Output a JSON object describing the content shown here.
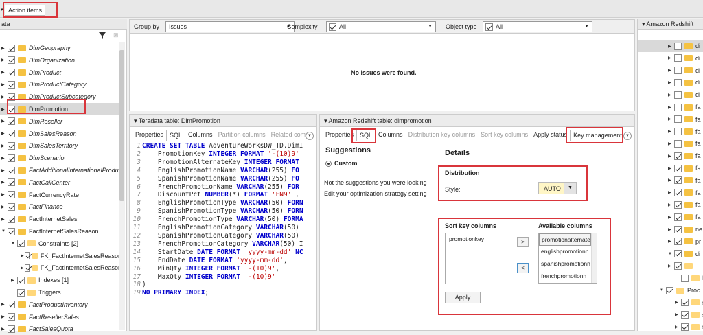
{
  "top_tab": "Action items",
  "left": {
    "header": "ata",
    "items": [
      {
        "t": "DimGeography",
        "lvl": 0,
        "c": true,
        "i": true
      },
      {
        "t": "DimOrganization",
        "lvl": 0,
        "c": true,
        "i": true
      },
      {
        "t": "DimProduct",
        "lvl": 0,
        "c": true,
        "i": true
      },
      {
        "t": "DimProductCategory",
        "lvl": 0,
        "c": true,
        "i": true
      },
      {
        "t": "DimProductSubcategory",
        "lvl": 0,
        "c": true,
        "i": true
      },
      {
        "t": "DimPromotion",
        "lvl": 0,
        "c": true,
        "i": false,
        "sel": true
      },
      {
        "t": "DimReseller",
        "lvl": 0,
        "c": true,
        "i": true
      },
      {
        "t": "DimSalesReason",
        "lvl": 0,
        "c": true,
        "i": true
      },
      {
        "t": "DimSalesTerritory",
        "lvl": 0,
        "c": true,
        "i": true
      },
      {
        "t": "DimScenario",
        "lvl": 0,
        "c": true,
        "i": true
      },
      {
        "t": "FactAdditionalInternationalProdu",
        "lvl": 0,
        "c": true,
        "i": true
      },
      {
        "t": "FactCallCenter",
        "lvl": 0,
        "c": true,
        "i": true
      },
      {
        "t": "FactCurrencyRate",
        "lvl": 0,
        "c": true,
        "i": false
      },
      {
        "t": "FactFinance",
        "lvl": 0,
        "c": true,
        "i": true
      },
      {
        "t": "FactInternetSales",
        "lvl": 0,
        "c": true,
        "i": false
      },
      {
        "t": "FactInternetSalesReason",
        "lvl": 0,
        "c": true,
        "i": false,
        "open": true
      },
      {
        "t": "Constraints [2]",
        "lvl": 1,
        "c": true,
        "i": false,
        "open": true,
        "folder": true
      },
      {
        "t": "FK_FactInternetSalesReason",
        "lvl": 2,
        "c": true,
        "i": false,
        "folder": true
      },
      {
        "t": "FK_FactInternetSalesReason",
        "lvl": 2,
        "c": true,
        "i": false,
        "folder": true
      },
      {
        "t": "Indexes [1]",
        "lvl": 1,
        "c": true,
        "i": false,
        "folder": true
      },
      {
        "t": "Triggers",
        "lvl": 1,
        "c": true,
        "i": false,
        "folder": true,
        "noarrow": true
      },
      {
        "t": "FactProductInventory",
        "lvl": 0,
        "c": true,
        "i": true
      },
      {
        "t": "FactResellerSales",
        "lvl": 0,
        "c": true,
        "i": true
      },
      {
        "t": "FactSalesQuota",
        "lvl": 0,
        "c": true,
        "i": true
      }
    ]
  },
  "toolbar": {
    "group_by_label": "Group by",
    "group_by": "Issues",
    "complexity_label": "Complexity",
    "complexity": "All",
    "object_type_label": "Object type",
    "object_type": "All"
  },
  "issues_msg": "No issues were found.",
  "td": {
    "title": "Teradata table: DimPromotion",
    "tabs": [
      "Properties",
      "SQL",
      "Columns",
      "Partition columns",
      "Related com"
    ],
    "code": [
      [
        "kw",
        "CREATE SET TABLE "
      ],
      [
        "",
        "AdventureWorksDW_TD.DimI"
      ]
    ]
  },
  "rs": {
    "title": "Amazon Redshift table: dimpromotion",
    "tabs": [
      "Properties",
      "SQL",
      "Columns",
      "Distribution key columns",
      "Sort key columns",
      "Apply status",
      "Key management"
    ],
    "suggestions": "Suggestions",
    "custom": "Custom",
    "note1": "Not the suggestions you were looking",
    "note2": "Edit your optimization strategy setting",
    "details": "Details",
    "distribution": "Distribution",
    "style_label": "Style:",
    "style": "AUTO",
    "sort_label": "Sort key columns",
    "avail_label": "Available columns",
    "sort_items": [
      "promotionkey"
    ],
    "avail_items": [
      "promotionalternate",
      "englishpromotionn",
      "spanishpromotionn",
      "frenchpromotionn"
    ],
    "move_right": ">",
    "move_left": "<",
    "apply": "Apply"
  },
  "right": {
    "header": "Amazon Redshift",
    "items": [
      "di",
      "di",
      "di",
      "di",
      "di",
      "fa",
      "fa",
      "fa",
      "fa",
      "fa",
      "fa",
      "fa",
      "fa",
      "fa",
      "fa",
      "ne",
      "pr",
      "di",
      "",
      "Func",
      "Proc",
      "sp",
      "sp",
      "sp"
    ]
  }
}
